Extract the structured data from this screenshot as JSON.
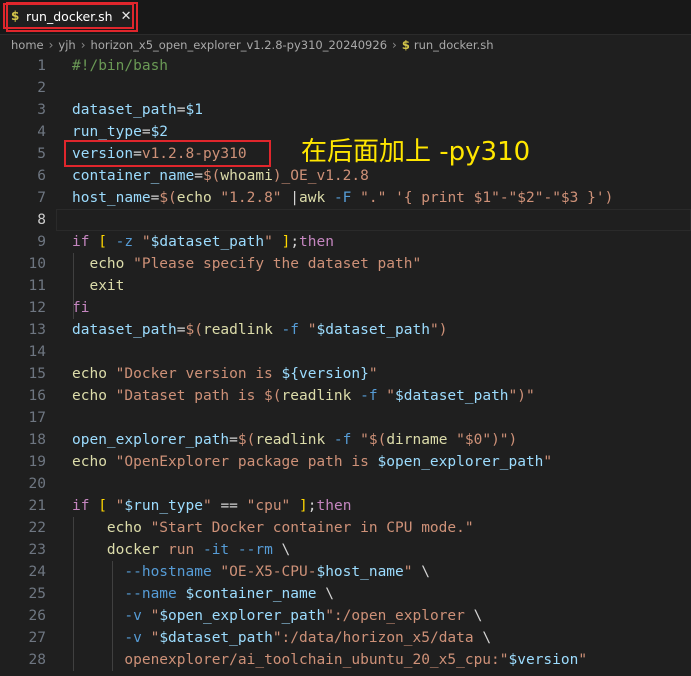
{
  "tab": {
    "icon": "$",
    "label": "run_docker.sh",
    "close": "✕"
  },
  "breadcrumb": [
    "home",
    "yjh",
    "horizon_x5_open_explorer_v1.2.8-py310_20240926",
    "run_docker.sh"
  ],
  "breadcrumb_sep": "›",
  "breadcrumb_file_icon": "$",
  "annotation": "在后面加上  -py310",
  "colors": {
    "highlight": "#e0262c",
    "annotation": "#ffe600"
  },
  "lines": [
    {
      "n": "1",
      "parts": [
        {
          "c": "c",
          "t": "#!/bin/bash"
        }
      ]
    },
    {
      "n": "2",
      "parts": []
    },
    {
      "n": "3",
      "parts": [
        {
          "c": "v",
          "t": "dataset_path"
        },
        {
          "c": "o",
          "t": "="
        },
        {
          "c": "v",
          "t": "$1"
        }
      ]
    },
    {
      "n": "4",
      "parts": [
        {
          "c": "v",
          "t": "run_type"
        },
        {
          "c": "o",
          "t": "="
        },
        {
          "c": "v",
          "t": "$2"
        }
      ]
    },
    {
      "n": "5",
      "parts": [
        {
          "c": "v",
          "t": "version"
        },
        {
          "c": "o",
          "t": "="
        },
        {
          "c": "s",
          "t": "v1.2.8-py310"
        }
      ]
    },
    {
      "n": "6",
      "parts": [
        {
          "c": "v",
          "t": "container_name"
        },
        {
          "c": "o",
          "t": "="
        },
        {
          "c": "s",
          "t": "$("
        },
        {
          "c": "f",
          "t": "whoami"
        },
        {
          "c": "s",
          "t": ")_OE_v1.2.8"
        }
      ]
    },
    {
      "n": "7",
      "parts": [
        {
          "c": "v",
          "t": "host_name"
        },
        {
          "c": "o",
          "t": "="
        },
        {
          "c": "s",
          "t": "$("
        },
        {
          "c": "f",
          "t": "echo"
        },
        {
          "c": "s",
          "t": " \"1.2.8\" "
        },
        {
          "c": "o",
          "t": "|"
        },
        {
          "c": "f",
          "t": "awk"
        },
        {
          "c": "k",
          "t": " -F"
        },
        {
          "c": "s",
          "t": " \".\" '{ print $1\"-\"$2\"-\"$3 }'"
        },
        {
          "c": "s",
          "t": ")"
        }
      ]
    },
    {
      "n": "8",
      "parts": []
    },
    {
      "n": "9",
      "parts": [
        {
          "c": "y",
          "t": "if"
        },
        {
          "c": "o",
          "t": " "
        },
        {
          "c": "b",
          "t": "["
        },
        {
          "c": "o",
          "t": " "
        },
        {
          "c": "k",
          "t": "-z"
        },
        {
          "c": "s",
          "t": " \""
        },
        {
          "c": "v",
          "t": "$dataset_path"
        },
        {
          "c": "s",
          "t": "\""
        },
        {
          "c": "o",
          "t": " "
        },
        {
          "c": "b",
          "t": "]"
        },
        {
          "c": "o",
          "t": ";"
        },
        {
          "c": "y",
          "t": "then"
        }
      ]
    },
    {
      "n": "10",
      "parts": [
        {
          "c": "o",
          "t": "  "
        },
        {
          "c": "f",
          "t": "echo"
        },
        {
          "c": "s",
          "t": " \"Please specify the dataset path\""
        }
      ]
    },
    {
      "n": "11",
      "parts": [
        {
          "c": "o",
          "t": "  "
        },
        {
          "c": "f",
          "t": "exit"
        }
      ]
    },
    {
      "n": "12",
      "parts": [
        {
          "c": "y",
          "t": "fi"
        }
      ]
    },
    {
      "n": "13",
      "parts": [
        {
          "c": "v",
          "t": "dataset_path"
        },
        {
          "c": "o",
          "t": "="
        },
        {
          "c": "s",
          "t": "$("
        },
        {
          "c": "f",
          "t": "readlink"
        },
        {
          "c": "k",
          "t": " -f"
        },
        {
          "c": "s",
          "t": " \""
        },
        {
          "c": "v",
          "t": "$dataset_path"
        },
        {
          "c": "s",
          "t": "\")"
        }
      ]
    },
    {
      "n": "14",
      "parts": []
    },
    {
      "n": "15",
      "parts": [
        {
          "c": "f",
          "t": "echo"
        },
        {
          "c": "s",
          "t": " \"Docker version is "
        },
        {
          "c": "v",
          "t": "${version}"
        },
        {
          "c": "s",
          "t": "\""
        }
      ]
    },
    {
      "n": "16",
      "parts": [
        {
          "c": "f",
          "t": "echo"
        },
        {
          "c": "s",
          "t": " \"Dataset path is $("
        },
        {
          "c": "f",
          "t": "readlink"
        },
        {
          "c": "k",
          "t": " -f"
        },
        {
          "c": "s",
          "t": " \""
        },
        {
          "c": "v",
          "t": "$dataset_path"
        },
        {
          "c": "s",
          "t": "\")\""
        }
      ]
    },
    {
      "n": "17",
      "parts": []
    },
    {
      "n": "18",
      "parts": [
        {
          "c": "v",
          "t": "open_explorer_path"
        },
        {
          "c": "o",
          "t": "="
        },
        {
          "c": "s",
          "t": "$("
        },
        {
          "c": "f",
          "t": "readlink"
        },
        {
          "c": "k",
          "t": " -f"
        },
        {
          "c": "s",
          "t": " \"$("
        },
        {
          "c": "f",
          "t": "dirname"
        },
        {
          "c": "s",
          "t": " \"$0\")\")"
        }
      ]
    },
    {
      "n": "19",
      "parts": [
        {
          "c": "f",
          "t": "echo"
        },
        {
          "c": "s",
          "t": " \"OpenExplorer package path is "
        },
        {
          "c": "v",
          "t": "$open_explorer_path"
        },
        {
          "c": "s",
          "t": "\""
        }
      ]
    },
    {
      "n": "20",
      "parts": []
    },
    {
      "n": "21",
      "parts": [
        {
          "c": "y",
          "t": "if"
        },
        {
          "c": "o",
          "t": " "
        },
        {
          "c": "b",
          "t": "["
        },
        {
          "c": "s",
          "t": " \""
        },
        {
          "c": "v",
          "t": "$run_type"
        },
        {
          "c": "s",
          "t": "\""
        },
        {
          "c": "o",
          "t": " == "
        },
        {
          "c": "s",
          "t": "\"cpu\""
        },
        {
          "c": "o",
          "t": " "
        },
        {
          "c": "b",
          "t": "]"
        },
        {
          "c": "o",
          "t": ";"
        },
        {
          "c": "y",
          "t": "then"
        }
      ]
    },
    {
      "n": "22",
      "parts": [
        {
          "c": "o",
          "t": "    "
        },
        {
          "c": "f",
          "t": "echo"
        },
        {
          "c": "s",
          "t": " \"Start Docker container in CPU mode.\""
        }
      ]
    },
    {
      "n": "23",
      "parts": [
        {
          "c": "o",
          "t": "    "
        },
        {
          "c": "f",
          "t": "docker"
        },
        {
          "c": "s",
          "t": " run"
        },
        {
          "c": "k",
          "t": " -it --rm"
        },
        {
          "c": "o",
          "t": " \\"
        }
      ]
    },
    {
      "n": "24",
      "parts": [
        {
          "c": "o",
          "t": "      "
        },
        {
          "c": "k",
          "t": "--hostname"
        },
        {
          "c": "s",
          "t": " \"OE-X5-CPU-"
        },
        {
          "c": "v",
          "t": "$host_name"
        },
        {
          "c": "s",
          "t": "\""
        },
        {
          "c": "o",
          "t": " \\"
        }
      ]
    },
    {
      "n": "25",
      "parts": [
        {
          "c": "o",
          "t": "      "
        },
        {
          "c": "k",
          "t": "--name"
        },
        {
          "c": "o",
          "t": " "
        },
        {
          "c": "v",
          "t": "$container_name"
        },
        {
          "c": "o",
          "t": " \\"
        }
      ]
    },
    {
      "n": "26",
      "parts": [
        {
          "c": "o",
          "t": "      "
        },
        {
          "c": "k",
          "t": "-v"
        },
        {
          "c": "s",
          "t": " \""
        },
        {
          "c": "v",
          "t": "$open_explorer_path"
        },
        {
          "c": "s",
          "t": "\":/open_explorer"
        },
        {
          "c": "o",
          "t": " \\"
        }
      ]
    },
    {
      "n": "27",
      "parts": [
        {
          "c": "o",
          "t": "      "
        },
        {
          "c": "k",
          "t": "-v"
        },
        {
          "c": "s",
          "t": " \""
        },
        {
          "c": "v",
          "t": "$dataset_path"
        },
        {
          "c": "s",
          "t": "\":/data/horizon_x5/data"
        },
        {
          "c": "o",
          "t": " \\"
        }
      ]
    },
    {
      "n": "28",
      "parts": [
        {
          "c": "o",
          "t": "      "
        },
        {
          "c": "s",
          "t": "openexplorer/ai_toolchain_ubuntu_20_x5_cpu:\""
        },
        {
          "c": "v",
          "t": "$version"
        },
        {
          "c": "s",
          "t": "\""
        }
      ]
    }
  ]
}
